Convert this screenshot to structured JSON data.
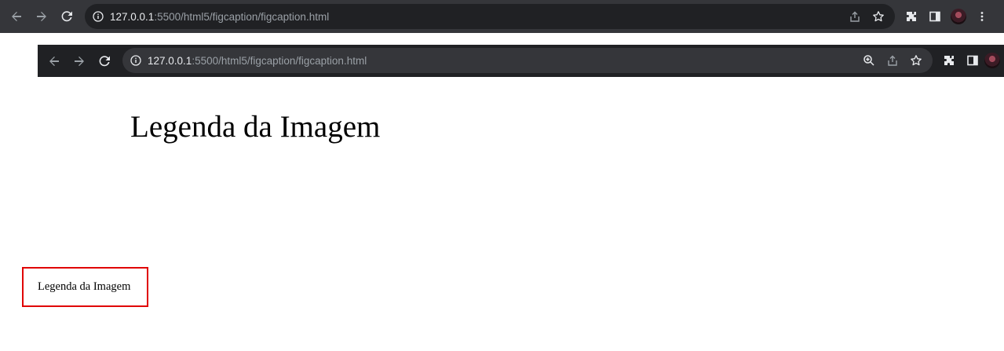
{
  "outer_browser": {
    "url_host": "127.0.0.1",
    "url_path": ":5500/html5/figcaption/figcaption.html"
  },
  "inner_browser": {
    "url_host": "127.0.0.1",
    "url_path": ":5500/html5/figcaption/figcaption.html"
  },
  "page": {
    "heading": "Legenda da Imagem",
    "caption": "Legenda da Imagem"
  },
  "icons": {
    "back": "arrow-left-icon",
    "forward": "arrow-right-icon",
    "reload": "reload-icon",
    "info": "info-icon",
    "share": "share-icon",
    "bookmark": "star-icon",
    "zoom": "zoom-in-icon",
    "extensions": "puzzle-icon",
    "side_panel": "side-panel-icon",
    "profile": "avatar",
    "menu": "kebab-menu-icon"
  },
  "colors": {
    "toolbar_outer": "#35363a",
    "toolbar_inner": "#202124",
    "highlight_border": "#e00000"
  }
}
